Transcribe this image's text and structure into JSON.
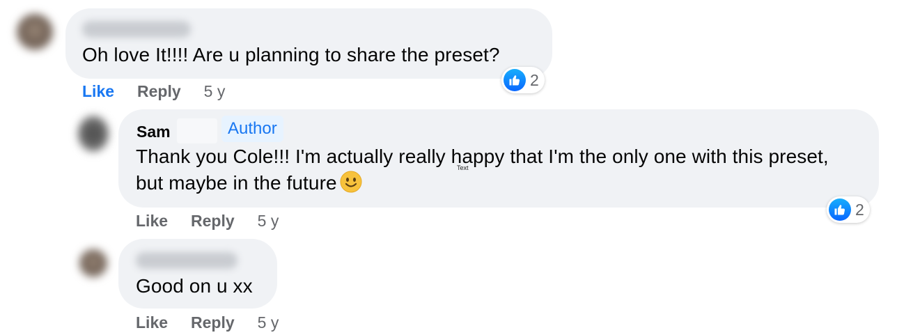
{
  "comments": [
    {
      "text": "Oh love It!!!! Are u planning to share the preset?",
      "reaction_count": "2",
      "actions": {
        "like": "Like",
        "reply": "Reply",
        "time": "5 y"
      }
    },
    {
      "author_name": "Sam",
      "author_badge": "Author",
      "text": "Thank you Cole!!! I'm actually really happy that I'm the only one with this preset, but maybe in the future",
      "emoji": "slightly-smiling-face-icon",
      "reaction_count": "2",
      "actions": {
        "like": "Like",
        "reply": "Reply",
        "time": "5 y"
      }
    },
    {
      "text": "Good on u xx",
      "actions": {
        "like": "Like",
        "reply": "Reply",
        "time": "5 y"
      }
    }
  ],
  "tooltip": "Text",
  "colors": {
    "bubble": "#f0f2f5",
    "accent": "#1877f2",
    "secondary_text": "#65676b"
  }
}
